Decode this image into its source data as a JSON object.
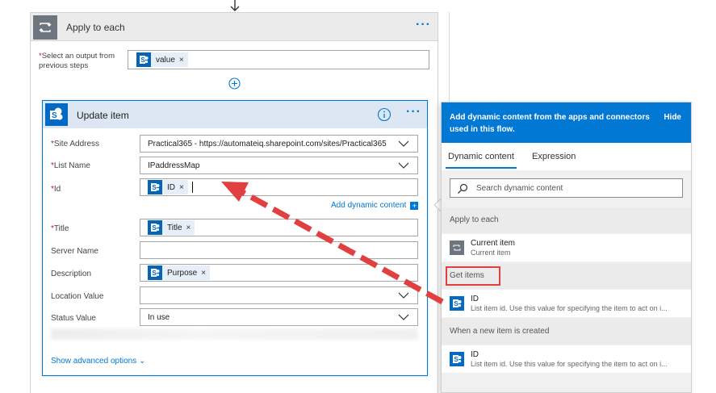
{
  "apply_to_each": {
    "title": "Apply to each",
    "more": "···",
    "select_label_required": "*",
    "select_label": "Select an output from previous steps",
    "value_token": "value",
    "token_remove": "×"
  },
  "update_item": {
    "title": "Update item",
    "more": "···",
    "required_mark": "*",
    "fields": {
      "site_address": {
        "label": "Site Address",
        "value": "Practical365 - https://automateiq.sharepoint.com/sites/Practical365"
      },
      "list_name": {
        "label": "List Name",
        "value": "IPaddressMap"
      },
      "id": {
        "label": "Id",
        "token": "ID"
      },
      "title": {
        "label": "Title",
        "token": "Title"
      },
      "server_name": {
        "label": "Server Name"
      },
      "description": {
        "label": "Description",
        "token": "Purpose"
      },
      "location_value": {
        "label": "Location Value"
      },
      "status_value": {
        "label": "Status Value",
        "value": "In use"
      }
    },
    "add_dynamic_content": "Add dynamic content",
    "add_dynamic_plus": "+",
    "show_advanced": "Show advanced options",
    "show_advanced_chevron": "⌄"
  },
  "dynamic_panel": {
    "header": "Add dynamic content from the apps and connectors used in this flow.",
    "hide": "Hide",
    "tabs": [
      "Dynamic content",
      "Expression"
    ],
    "search_placeholder": "Search dynamic content",
    "sections": [
      {
        "name": "Apply to each",
        "item_title": "Current item",
        "item_sub": "Current item"
      },
      {
        "name": "Get items",
        "item_title": "ID",
        "item_sub": "List item id. Use this value for specifying the item to act on i..."
      },
      {
        "name": "When a new item is created",
        "item_title": "ID",
        "item_sub": "List item id. Use this value for specifying the item to act on i..."
      }
    ]
  },
  "colors": {
    "accent": "#0078d4",
    "sharepoint": "#036ac4",
    "annotation_red": "#e0403f"
  }
}
